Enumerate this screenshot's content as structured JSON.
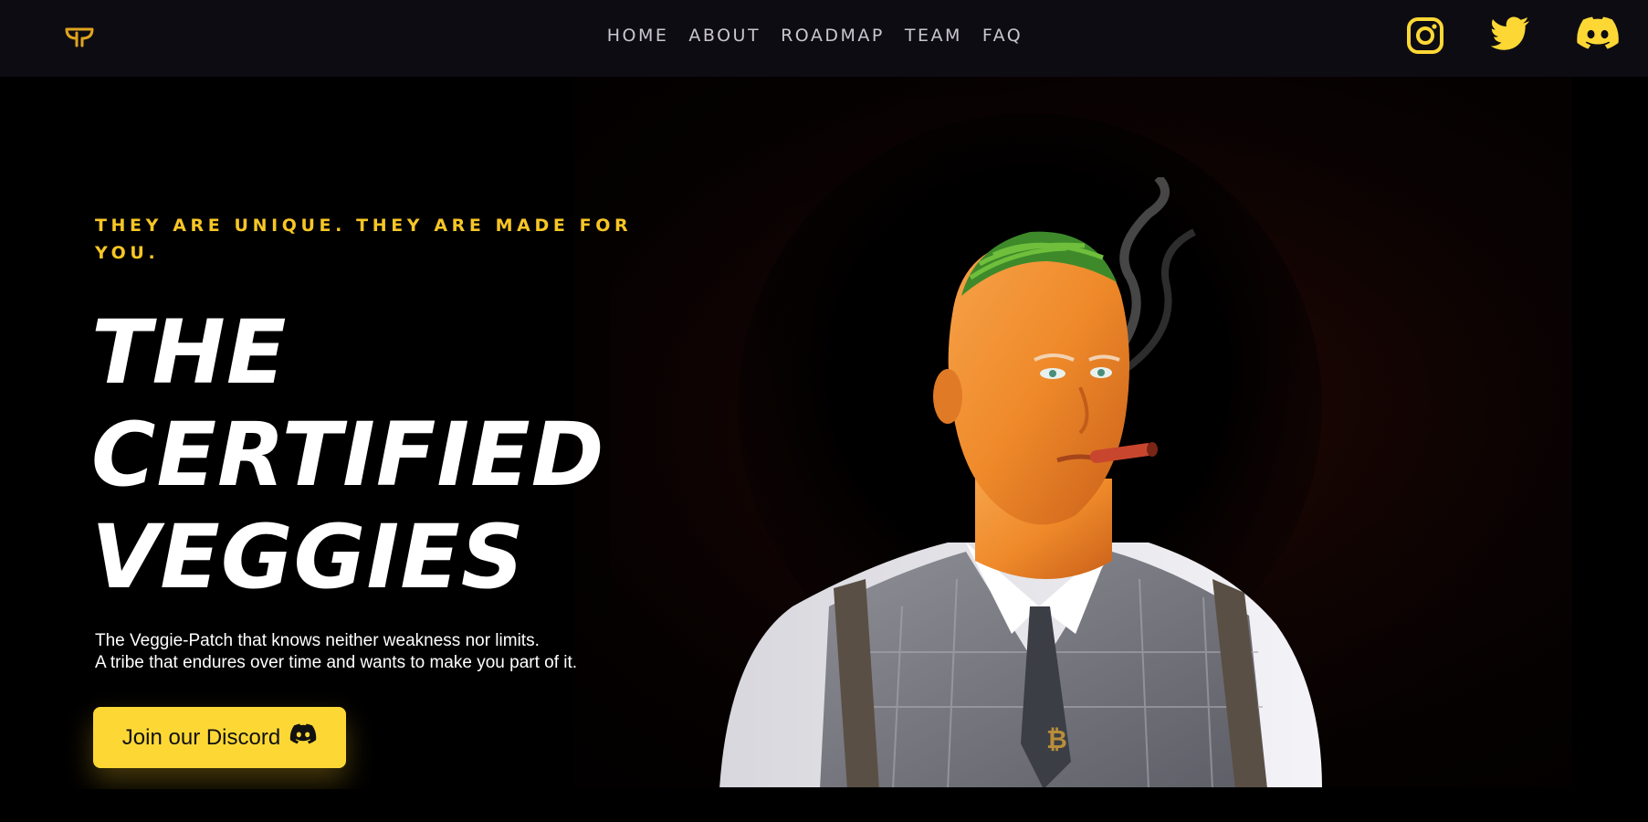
{
  "nav": {
    "logo_icon": "veggie-logo-icon",
    "items": [
      {
        "label": "HOME"
      },
      {
        "label": "ABOUT"
      },
      {
        "label": "ROADMAP"
      },
      {
        "label": "TEAM"
      },
      {
        "label": "FAQ"
      }
    ],
    "social": [
      {
        "icon": "instagram-icon"
      },
      {
        "icon": "twitter-icon"
      },
      {
        "icon": "discord-icon"
      }
    ]
  },
  "hero": {
    "eyebrow": "THEY ARE UNIQUE. THEY ARE MADE FOR YOU.",
    "headline": [
      "THE",
      "CERTIFIED",
      "VEGGIES"
    ],
    "subtitle_lines": [
      "The Veggie-Patch that knows neither weakness nor limits.",
      "A tribe that endures over time and wants to make you part of it."
    ],
    "cta_label": "Join our Discord",
    "cta_icon": "discord-icon",
    "image": "carrot-headed-character-illustration"
  },
  "colors": {
    "accent": "#fdd835",
    "eyebrow": "#f7c625",
    "nav_bg": "#0e0c13",
    "page_bg": "#000000",
    "nav_text": "#c9c6cf"
  }
}
